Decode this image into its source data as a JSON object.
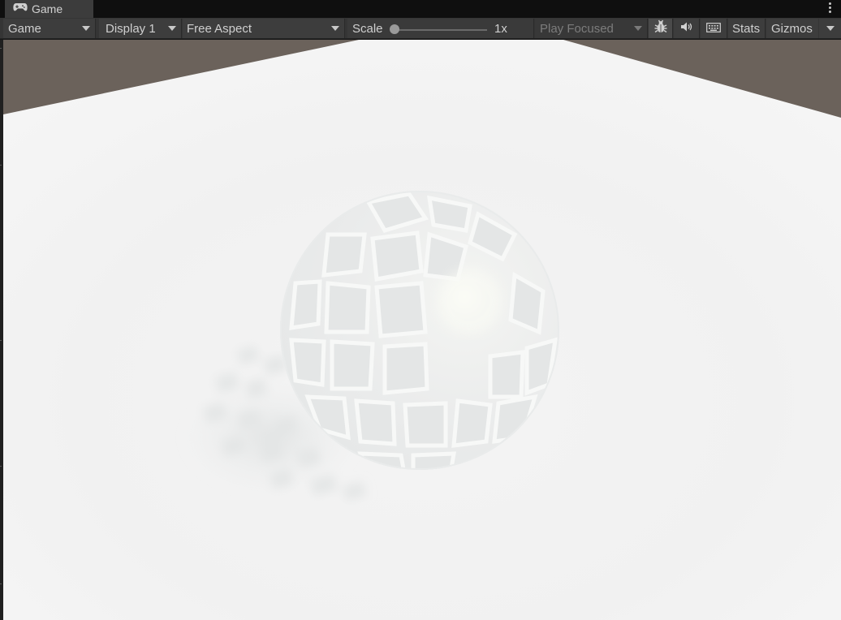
{
  "tab": {
    "icon": "gamepad-icon",
    "title": "Game"
  },
  "toolbar": {
    "view_select": "Game",
    "display_select": "Display 1",
    "aspect_select": "Free Aspect",
    "scale_label": "Scale",
    "scale_value": "1x",
    "scale_level": 0,
    "play_mode_select": "Play Focused",
    "bug_icon": "bug-icon",
    "audio_icon": "speaker-icon",
    "keyboard_icon": "keyboard-icon",
    "stats_button": "Stats",
    "gizmos_button": "Gizmos"
  },
  "scene": {
    "background_color": "#6b625b",
    "ground_color": "#f2f2f2",
    "sphere_color": "#eef0ef"
  }
}
